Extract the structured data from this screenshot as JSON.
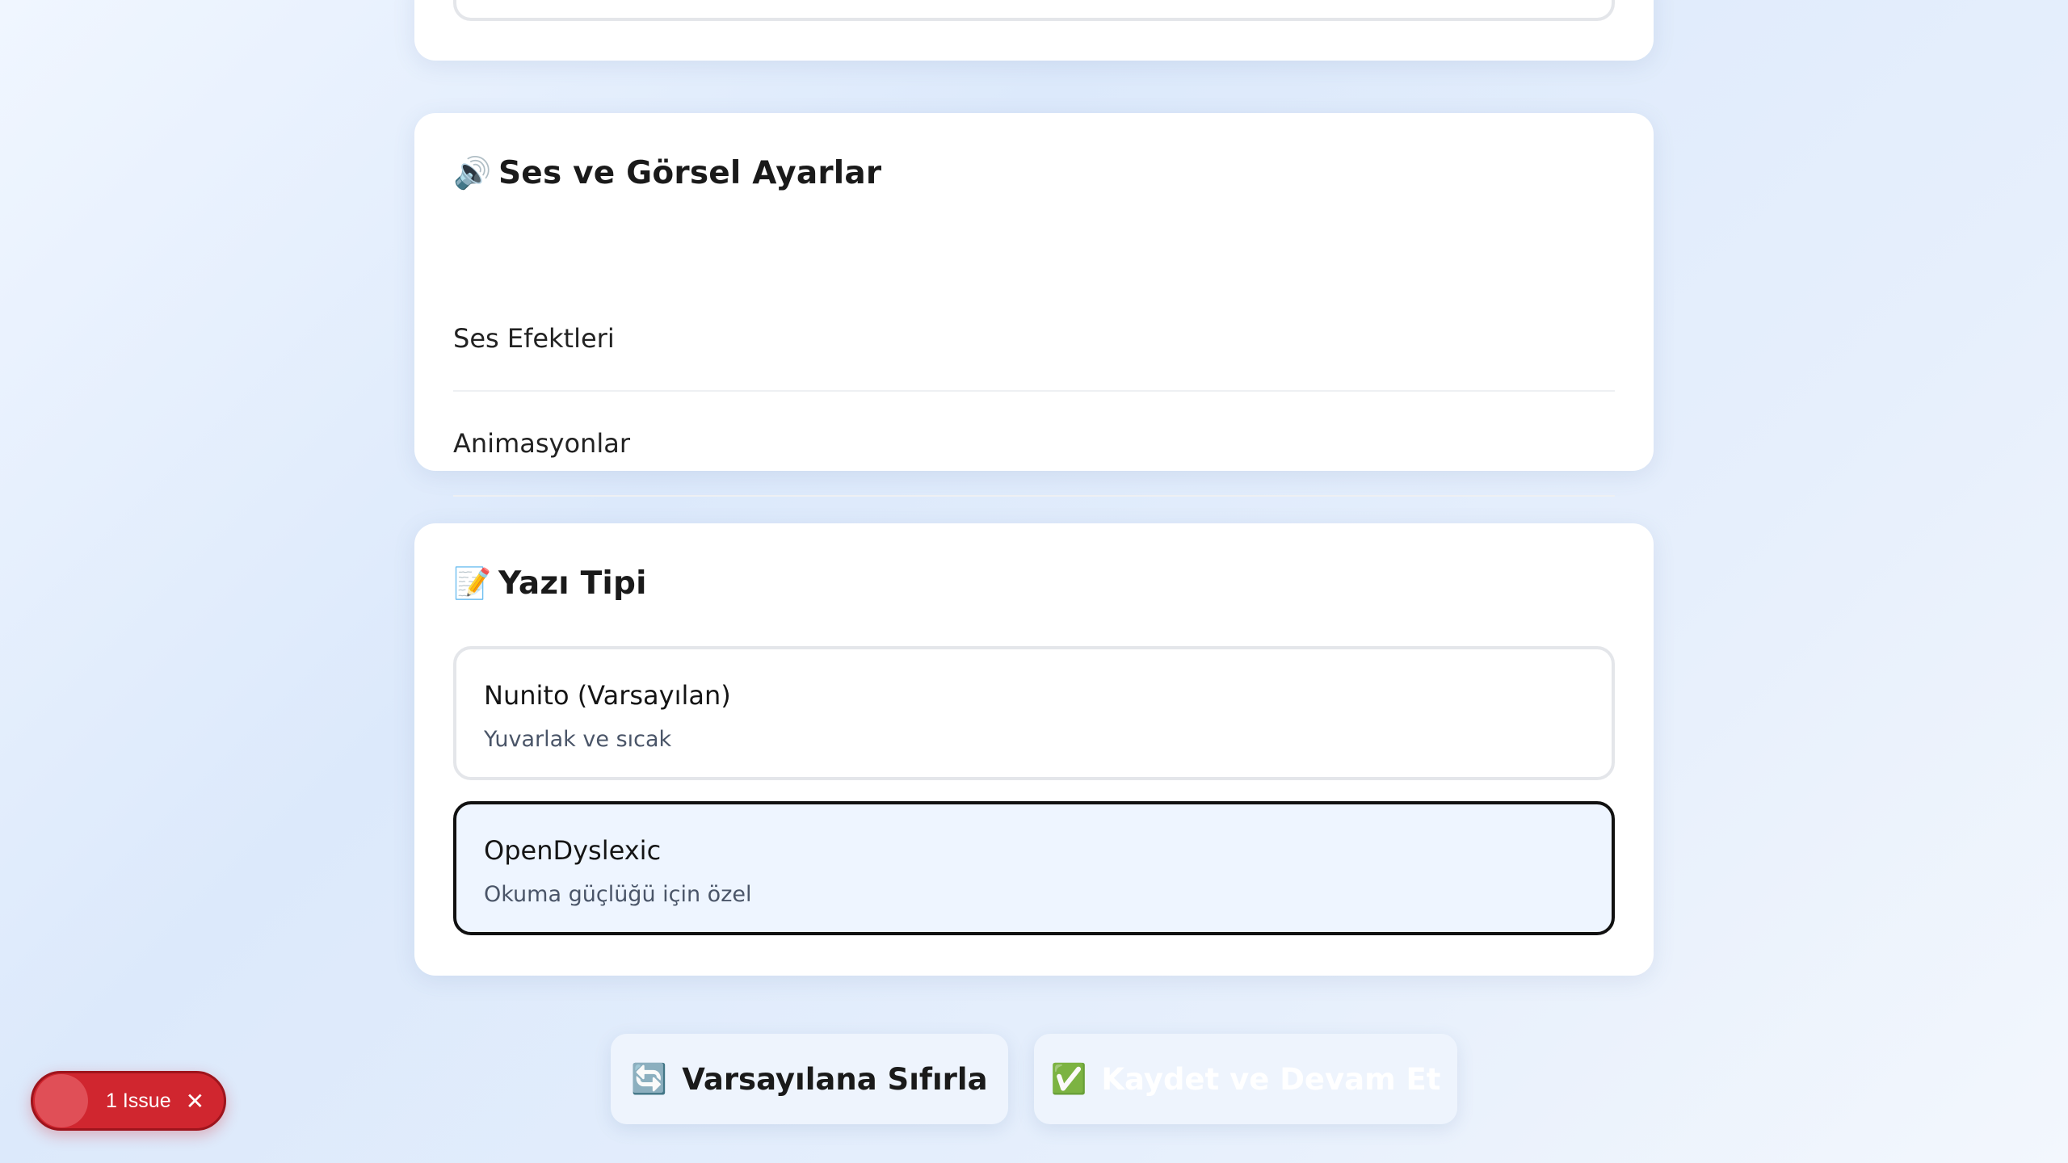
{
  "sound_section": {
    "icon": "🔊",
    "icon_name": "speaker-icon",
    "title": "Ses ve Görsel Ayarlar",
    "rows": [
      {
        "label": "Ses Efektleri"
      },
      {
        "label": "Animasyonlar"
      }
    ]
  },
  "font_section": {
    "icon": "📝",
    "icon_name": "memo-icon",
    "title": "Yazı Tipi",
    "options": [
      {
        "name": "Nunito (Varsayılan)",
        "description": "Yuvarlak ve sıcak",
        "selected": false
      },
      {
        "name": "OpenDyslexic",
        "description": "Okuma güçlüğü için özel",
        "selected": true
      }
    ]
  },
  "actions": {
    "reset_icon": "🔄",
    "reset_label": "Varsayılana Sıfırla",
    "save_icon": "✅",
    "save_label": "Kaydet ve Devam Et"
  },
  "issue_badge": {
    "label": "1 Issue",
    "close": "✕"
  },
  "colors": {
    "selected_border": "#111111",
    "selected_background": "#eef5ff",
    "issue_badge": "#d0262f"
  }
}
